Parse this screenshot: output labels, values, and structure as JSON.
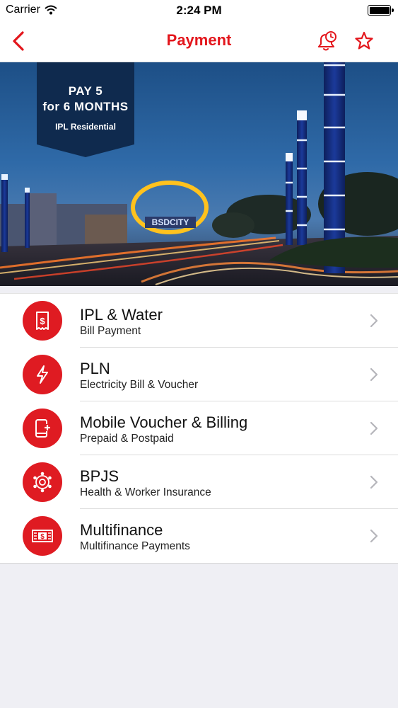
{
  "status_bar": {
    "carrier": "Carrier",
    "time": "2:24 PM"
  },
  "nav": {
    "title": "Payment",
    "back_icon": "chevron-left-icon",
    "reminder_icon": "bell-clock-icon",
    "favorite_icon": "star-outline-icon"
  },
  "banner": {
    "line1": "PAY 5",
    "line2": "for 6 MONTHS",
    "subtitle": "IPL Residential",
    "sign_text": "BSDCITY"
  },
  "menu": {
    "items": [
      {
        "title": "IPL & Water",
        "subtitle": "Bill Payment",
        "icon": "receipt-dollar-icon"
      },
      {
        "title": "PLN",
        "subtitle": "Electricity Bill & Voucher",
        "icon": "lightning-icon"
      },
      {
        "title": "Mobile Voucher & Billing",
        "subtitle": "Prepaid & Postpaid",
        "icon": "mobile-plus-icon"
      },
      {
        "title": "BPJS",
        "subtitle": "Health & Worker Insurance",
        "icon": "insurance-network-icon"
      },
      {
        "title": "Multifinance",
        "subtitle": "Multifinance Payments",
        "icon": "banknote-icon"
      }
    ]
  },
  "colors": {
    "accent": "#e3161c",
    "icon_bg": "#df1b22",
    "background": "#efeff4"
  }
}
